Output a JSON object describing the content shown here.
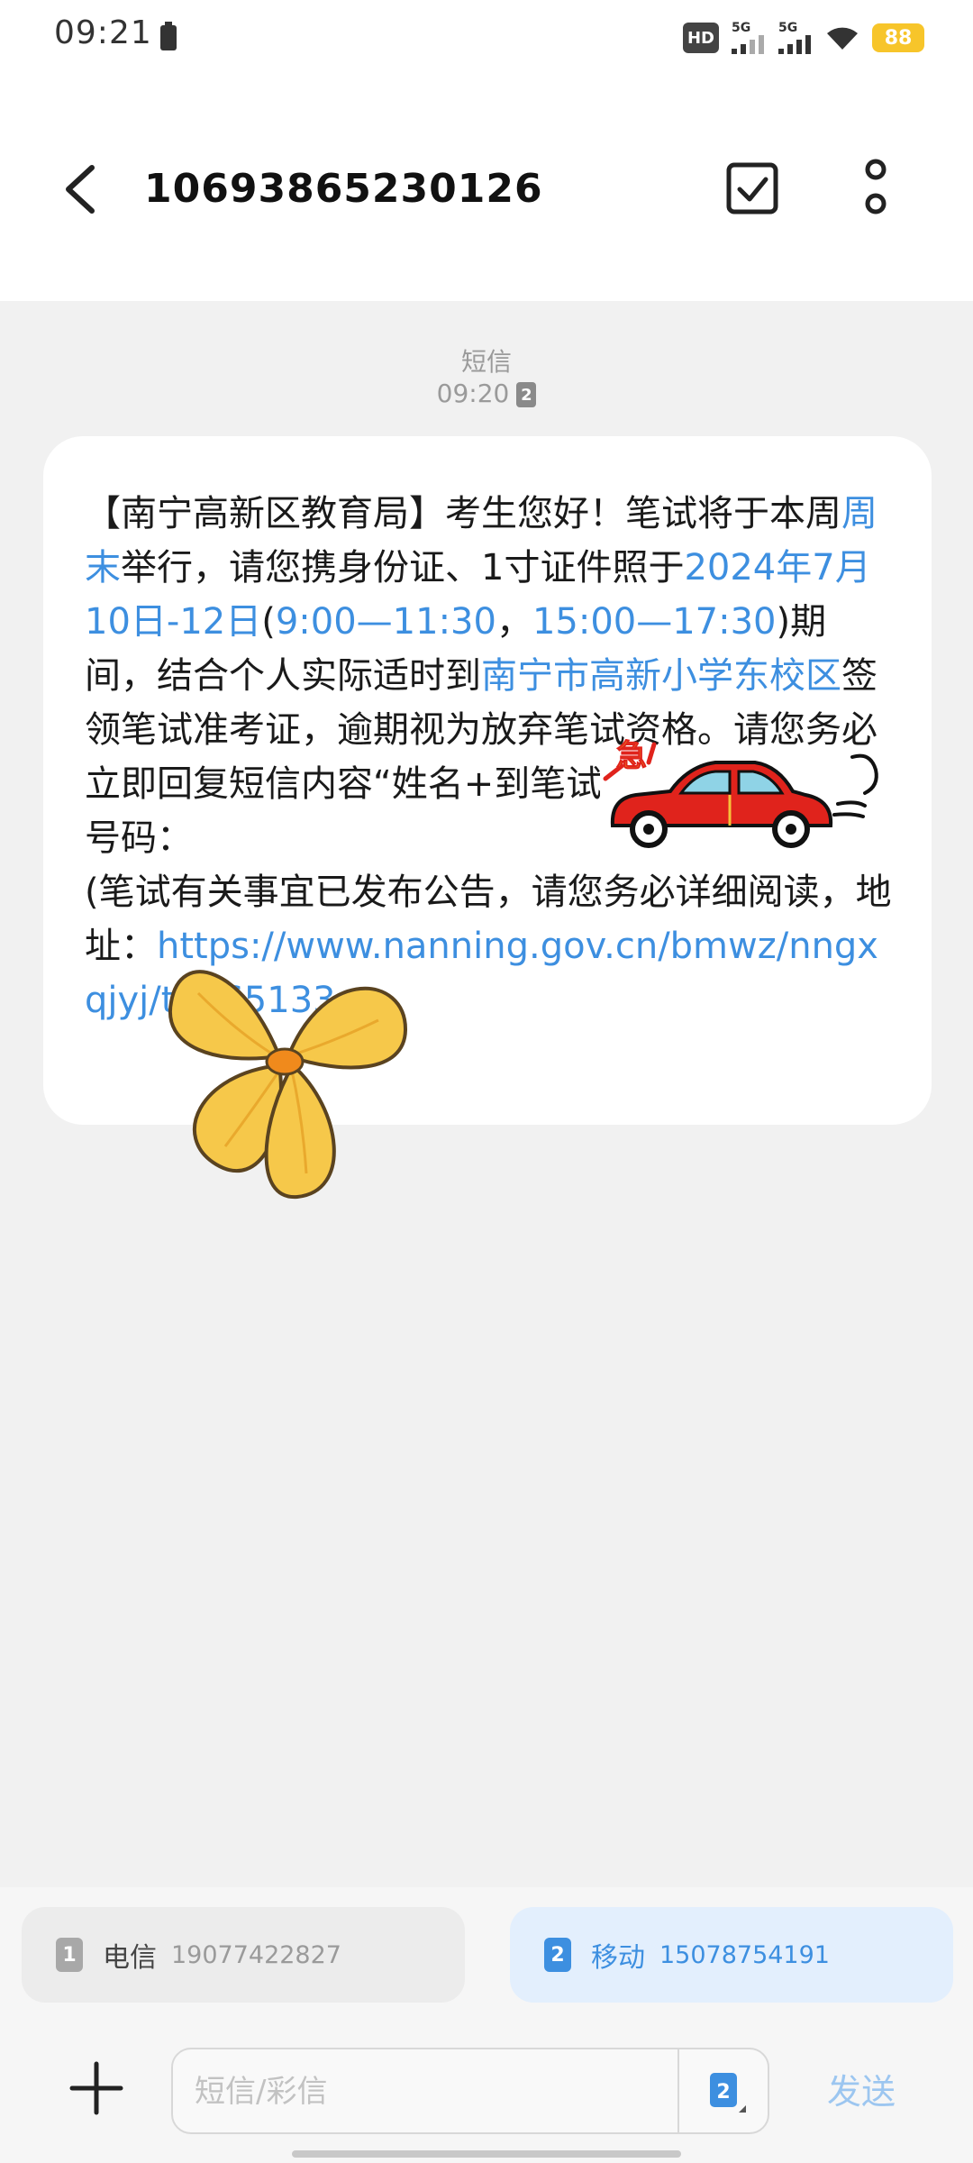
{
  "status_bar": {
    "time": "09:21",
    "hd_label": "HD",
    "signal1_label": "5G",
    "signal2_label": "5G",
    "battery_level": "88"
  },
  "header": {
    "title": "10693865230126",
    "back_icon": "chevron-left-icon",
    "select_icon": "checkbox-icon",
    "more_icon": "more-vertical-icon"
  },
  "message_meta": {
    "type_label": "短信",
    "time": "09:20",
    "sim_badge": "2"
  },
  "message": {
    "part1": "【南宁高新区教育局】考生您好！笔试将于本周",
    "link1": "周末",
    "part2": "举行，请您携身份证、1寸证件照于",
    "link2": "2024年7月10日-12日",
    "part3": "(",
    "link3": "9:00—11:30",
    "part4": "，",
    "link4": "15:00—17:30",
    "part5": ")期间，结合个人实际适时到",
    "link5": "南宁市高新小学东校区",
    "part6": "签领笔试准考证，逾期视为放弃笔试资格。请您务必立即回复短信内容“姓名+到笔试通知”发送至指定号码：",
    "part7": "(笔试有关事宜已发布公告，请您务必详细阅读，地址：",
    "url": "https://www.nanning.gov.cn/bmwz/nngxqjyj/t5965133"
  },
  "stickers": {
    "car_text": "急",
    "car_icon": "red-car-sticker",
    "flower_icon": "yellow-flower-sticker"
  },
  "sim_selector": {
    "sim1": {
      "slot": "1",
      "carrier": "电信",
      "number": "19077422827"
    },
    "sim2": {
      "slot": "2",
      "carrier": "移动",
      "number": "15078754191"
    }
  },
  "compose": {
    "placeholder": "短信/彩信",
    "sim_slot": "2",
    "send_label": "发送",
    "plus_icon": "plus-icon"
  },
  "colors": {
    "link": "#3d8fe0",
    "bubble": "#ffffff",
    "background": "#f1f1f1",
    "battery": "#f7c52a"
  }
}
